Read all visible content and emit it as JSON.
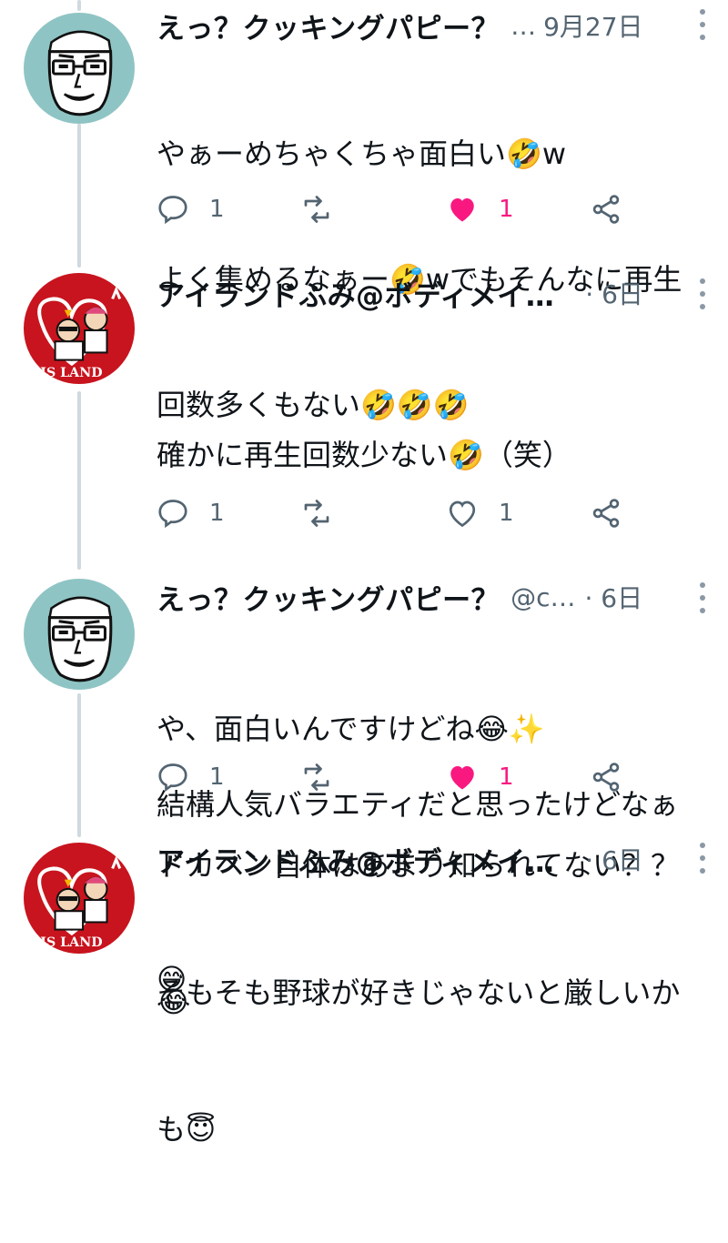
{
  "tweets": [
    {
      "name": "えっ？クッキングパピー？",
      "handle": "…",
      "time": "9月27日",
      "lines": [
        "やぁーめちゃくちゃ面白い🤣w",
        "よく集めるなぁー🤣wでもそんなに再生",
        "回数多くもない🤣🤣🤣"
      ],
      "reply_count": "1",
      "like_count": "1",
      "liked": true,
      "avatar": "cooking-puppy-avatar"
    },
    {
      "name": "アイランドふみ@ボディメイ…",
      "handle": "",
      "time": "· 6日",
      "lines": [
        "確かに再生回数少ない🤣（笑）",
        "",
        "結構人気バラエティだと思ったけどなぁ",
        "😅"
      ],
      "reply_count": "1",
      "like_count": "1",
      "liked": false,
      "avatar": "island-fumi-avatar"
    },
    {
      "name": "えっ？クッキングパピー？",
      "handle": "@c…",
      "time": "· 6日",
      "lines": [
        "や、面白いんですけどね😂✨",
        "ドカベン自体はあまり知られてない？？",
        "😂"
      ],
      "reply_count": "1",
      "like_count": "1",
      "liked": true,
      "avatar": "cooking-puppy-avatar"
    },
    {
      "name": "アイランドふみ@ボディメイ…",
      "handle": "",
      "time": "· 6日",
      "lines": [
        "そもそも野球が好きじゃないと厳しいか",
        "も😇"
      ],
      "avatar": "island-fumi-avatar"
    }
  ],
  "avatar_text": {
    "island": "IS LAND"
  },
  "colors": {
    "like_pink": "#f91880",
    "icon_gray": "#536471",
    "thread_line": "#cfd9de",
    "avatar_teal": "#8fc4c4",
    "avatar_red": "#c8141e"
  }
}
